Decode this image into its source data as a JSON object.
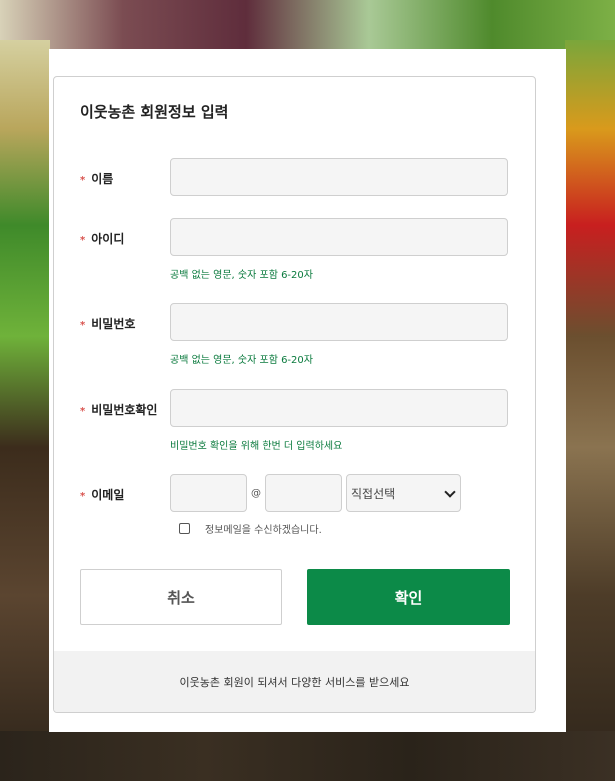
{
  "form": {
    "title": "이웃농촌 회원정보 입력",
    "required_mark": "*",
    "fields": {
      "name": {
        "label": "이름",
        "value": ""
      },
      "id": {
        "label": "아이디",
        "value": "",
        "hint": "공백 없는 영문, 숫자 포함 6-20자"
      },
      "password": {
        "label": "비밀번호",
        "value": "",
        "hint": "공백 없는 영문, 숫자 포함 6-20자"
      },
      "password_confirm": {
        "label": "비밀번호확인",
        "value": "",
        "hint": "비밀번호 확인을 위해 한번 더 입력하세요"
      },
      "email": {
        "label": "이메일",
        "local": "",
        "at": "@",
        "domain": "",
        "domain_select": "직접선택",
        "newsletter_label": "정보메일을 수신하겠습니다.",
        "newsletter_checked": false
      }
    },
    "buttons": {
      "cancel": "취소",
      "confirm": "확인"
    },
    "footer": "이웃농촌 회원이 되셔서 다양한 서비스를 받으세요"
  },
  "colors": {
    "accent": "#0c8a48",
    "hint": "#0a7a3d",
    "required": "#d9534f"
  }
}
